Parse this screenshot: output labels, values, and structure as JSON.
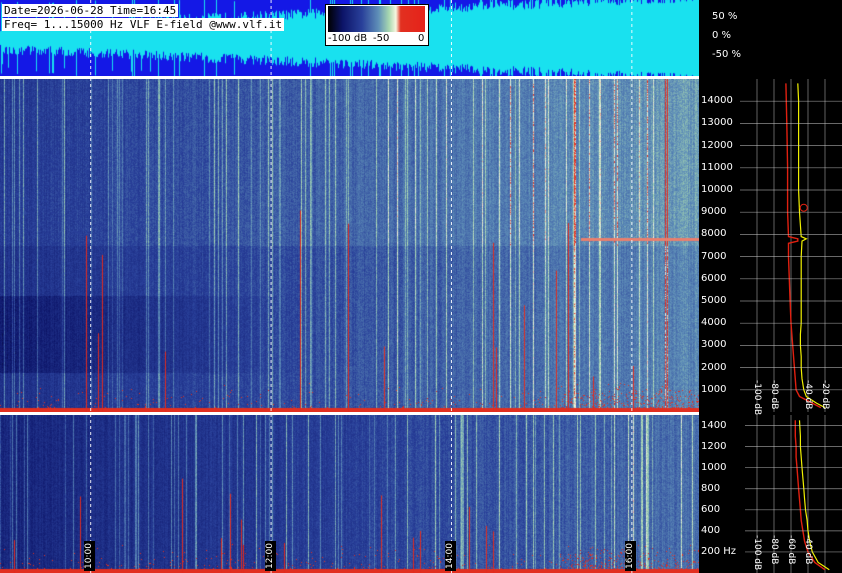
{
  "header": {
    "line1": "Date=2026-06-28 Time=16:45",
    "line2": "Freq= 1...15000 Hz   VLF E-field @www.vlf.it"
  },
  "colorbar": {
    "ticks": [
      "-100 dB",
      "-50",
      "0"
    ]
  },
  "colors": {
    "waveform_bg": "#1418e6",
    "waveform_trace": "#19e1ef",
    "spectrum_line": "#f0f000",
    "average_line": "#e02010",
    "grid": "#c8c8c8",
    "marker": "#ffffff"
  },
  "chart_data": [
    {
      "type": "area",
      "panel": "waveform",
      "y_ticks": [
        "50 %",
        "0 %",
        "-50 %"
      ],
      "ylim": [
        -100,
        100
      ],
      "x_range_hours": [
        9.0,
        16.75
      ]
    },
    {
      "type": "heatmap",
      "panel": "spectrogram-main",
      "ylim": [
        0,
        15000
      ],
      "y_ticks": [
        "1000",
        "2000",
        "3000",
        "4000",
        "5000",
        "6000",
        "7000",
        "8000",
        "9000",
        "10000",
        "11000",
        "12000",
        "13000",
        "14000"
      ],
      "x_range_hours": [
        9.0,
        16.75
      ],
      "time_markers": [
        "10:00",
        "12:00",
        "14:00",
        "16:00"
      ],
      "time_marker_hours": [
        10,
        12,
        14,
        16
      ],
      "color_scale_db": [
        -100,
        0
      ]
    },
    {
      "type": "heatmap",
      "panel": "spectrogram-zoom",
      "ylim": [
        0,
        1500
      ],
      "y_ticks": [
        "200 Hz",
        "400",
        "600",
        "800",
        "1000",
        "1200",
        "1400"
      ],
      "x_range_hours": [
        9.0,
        16.75
      ],
      "time_markers": [
        "10:00",
        "12:00",
        "14:00",
        "16:00"
      ],
      "time_marker_hours": [
        10,
        12,
        14,
        16
      ]
    },
    {
      "type": "line",
      "panel": "spectrum-main",
      "x_ticks": [
        "-100 dB",
        "-80 dB",
        "-40 dB",
        "-20 dB"
      ],
      "xlim": [
        -120,
        0
      ],
      "ylim": [
        0,
        15000
      ],
      "series": [
        {
          "role": "current",
          "points": [
            [
              200,
              -20
            ],
            [
              400,
              -30
            ],
            [
              700,
              -42
            ],
            [
              1000,
              -45
            ],
            [
              1500,
              -47
            ],
            [
              2000,
              -48
            ],
            [
              2500,
              -48
            ],
            [
              3000,
              -49
            ],
            [
              3500,
              -49
            ],
            [
              4000,
              -48
            ],
            [
              5000,
              -48
            ],
            [
              6000,
              -48
            ],
            [
              7000,
              -48
            ],
            [
              7700,
              -47
            ],
            [
              7800,
              -42
            ],
            [
              7900,
              -48
            ],
            [
              9000,
              -50
            ],
            [
              10000,
              -51
            ],
            [
              11000,
              -51
            ],
            [
              12000,
              -51
            ],
            [
              13000,
              -51
            ],
            [
              14000,
              -51
            ],
            [
              14800,
              -52
            ]
          ]
        },
        {
          "role": "average",
          "points": [
            [
              200,
              -25
            ],
            [
              400,
              -35
            ],
            [
              700,
              -50
            ],
            [
              1000,
              -54
            ],
            [
              2000,
              -56
            ],
            [
              3000,
              -58
            ],
            [
              4000,
              -60
            ],
            [
              5000,
              -61
            ],
            [
              6000,
              -62
            ],
            [
              7000,
              -63
            ],
            [
              7600,
              -63
            ],
            [
              7700,
              -52
            ],
            [
              7800,
              -52
            ],
            [
              7900,
              -63
            ],
            [
              9000,
              -64
            ],
            [
              11000,
              -64
            ],
            [
              13000,
              -65
            ],
            [
              14800,
              -66
            ]
          ]
        }
      ],
      "marker": {
        "freq": 9200,
        "db": -45
      }
    },
    {
      "type": "line",
      "panel": "spectrum-zoom",
      "x_ticks": [
        "-100 dB",
        "-80 dB",
        "-60 dB",
        "-40 dB"
      ],
      "xlim": [
        -120,
        0
      ],
      "ylim": [
        0,
        1500
      ],
      "series": [
        {
          "role": "current",
          "points": [
            [
              30,
              -15
            ],
            [
              100,
              -28
            ],
            [
              200,
              -35
            ],
            [
              300,
              -38
            ],
            [
              400,
              -40
            ],
            [
              500,
              -41
            ],
            [
              600,
              -43
            ],
            [
              700,
              -44
            ],
            [
              800,
              -45
            ],
            [
              900,
              -46
            ],
            [
              1000,
              -47
            ],
            [
              1100,
              -48
            ],
            [
              1200,
              -49
            ],
            [
              1300,
              -49
            ],
            [
              1450,
              -50
            ]
          ]
        },
        {
          "role": "average",
          "points": [
            [
              30,
              -20
            ],
            [
              100,
              -32
            ],
            [
              200,
              -40
            ],
            [
              300,
              -44
            ],
            [
              400,
              -46
            ],
            [
              500,
              -48
            ],
            [
              600,
              -49
            ],
            [
              700,
              -50
            ],
            [
              800,
              -51
            ],
            [
              900,
              -52
            ],
            [
              1000,
              -53
            ],
            [
              1100,
              -54
            ],
            [
              1200,
              -54
            ],
            [
              1300,
              -55
            ],
            [
              1450,
              -55
            ]
          ]
        }
      ]
    }
  ]
}
